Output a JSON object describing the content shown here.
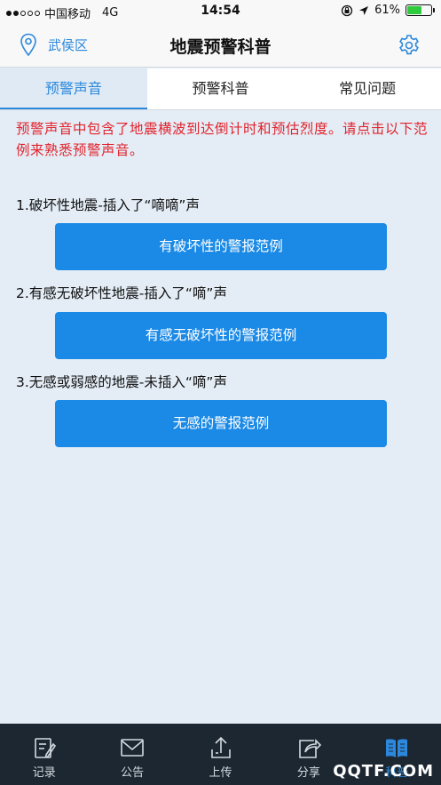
{
  "status_bar": {
    "carrier": "中国移动",
    "network": "4G",
    "time": "14:54",
    "battery": "61%",
    "battery_level": 0.61
  },
  "nav": {
    "location": "武侯区",
    "title": "地震预警科普"
  },
  "tabs": [
    {
      "label": "预警声音",
      "active": true
    },
    {
      "label": "预警科普",
      "active": false
    },
    {
      "label": "常见问题",
      "active": false
    }
  ],
  "intro": "预警声音中包含了地震横波到达倒计时和预估烈度。请点击以下范例来熟悉预警声音。",
  "examples": [
    {
      "title": "1.破坏性地震-插入了“嘀嘀”声",
      "button": "有破坏性的警报范例"
    },
    {
      "title": "2.有感无破坏性地震-插入了“嘀”声",
      "button": "有感无破坏性的警报范例"
    },
    {
      "title": "3.无感或弱感的地震-未插入“嘀”声",
      "button": "无感的警报范例"
    }
  ],
  "tab_bar": [
    {
      "label": "记录",
      "icon": "edit-record-icon"
    },
    {
      "label": "公告",
      "icon": "mail-icon"
    },
    {
      "label": "上传",
      "icon": "upload-icon"
    },
    {
      "label": "分享",
      "icon": "share-icon"
    },
    {
      "label": "科普",
      "icon": "book-icon",
      "active": true
    }
  ],
  "watermark": "QQTF.COM",
  "colors": {
    "accent": "#2b88dc",
    "button": "#1b8ae6",
    "intro_text": "#e2232c",
    "background": "#e4edf6",
    "tab_bar": "#1c2732"
  }
}
